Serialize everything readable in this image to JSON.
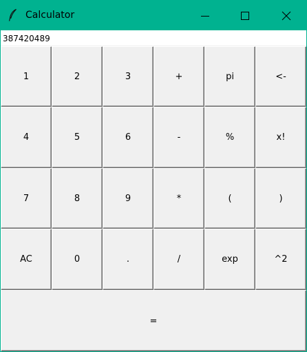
{
  "window": {
    "title": "Calculator",
    "accent": "#00b290",
    "controls": [
      "minimize",
      "maximize",
      "close"
    ]
  },
  "display": {
    "value": "387420489"
  },
  "keys": {
    "row1": [
      "1",
      "2",
      "3",
      "+",
      "pi",
      "<-"
    ],
    "row2": [
      "4",
      "5",
      "6",
      "-",
      "%",
      "x!"
    ],
    "row3": [
      "7",
      "8",
      "9",
      "*",
      "(",
      ")"
    ],
    "row4": [
      "AC",
      "0",
      ".",
      "/",
      "exp",
      "^2"
    ],
    "equals": "="
  }
}
